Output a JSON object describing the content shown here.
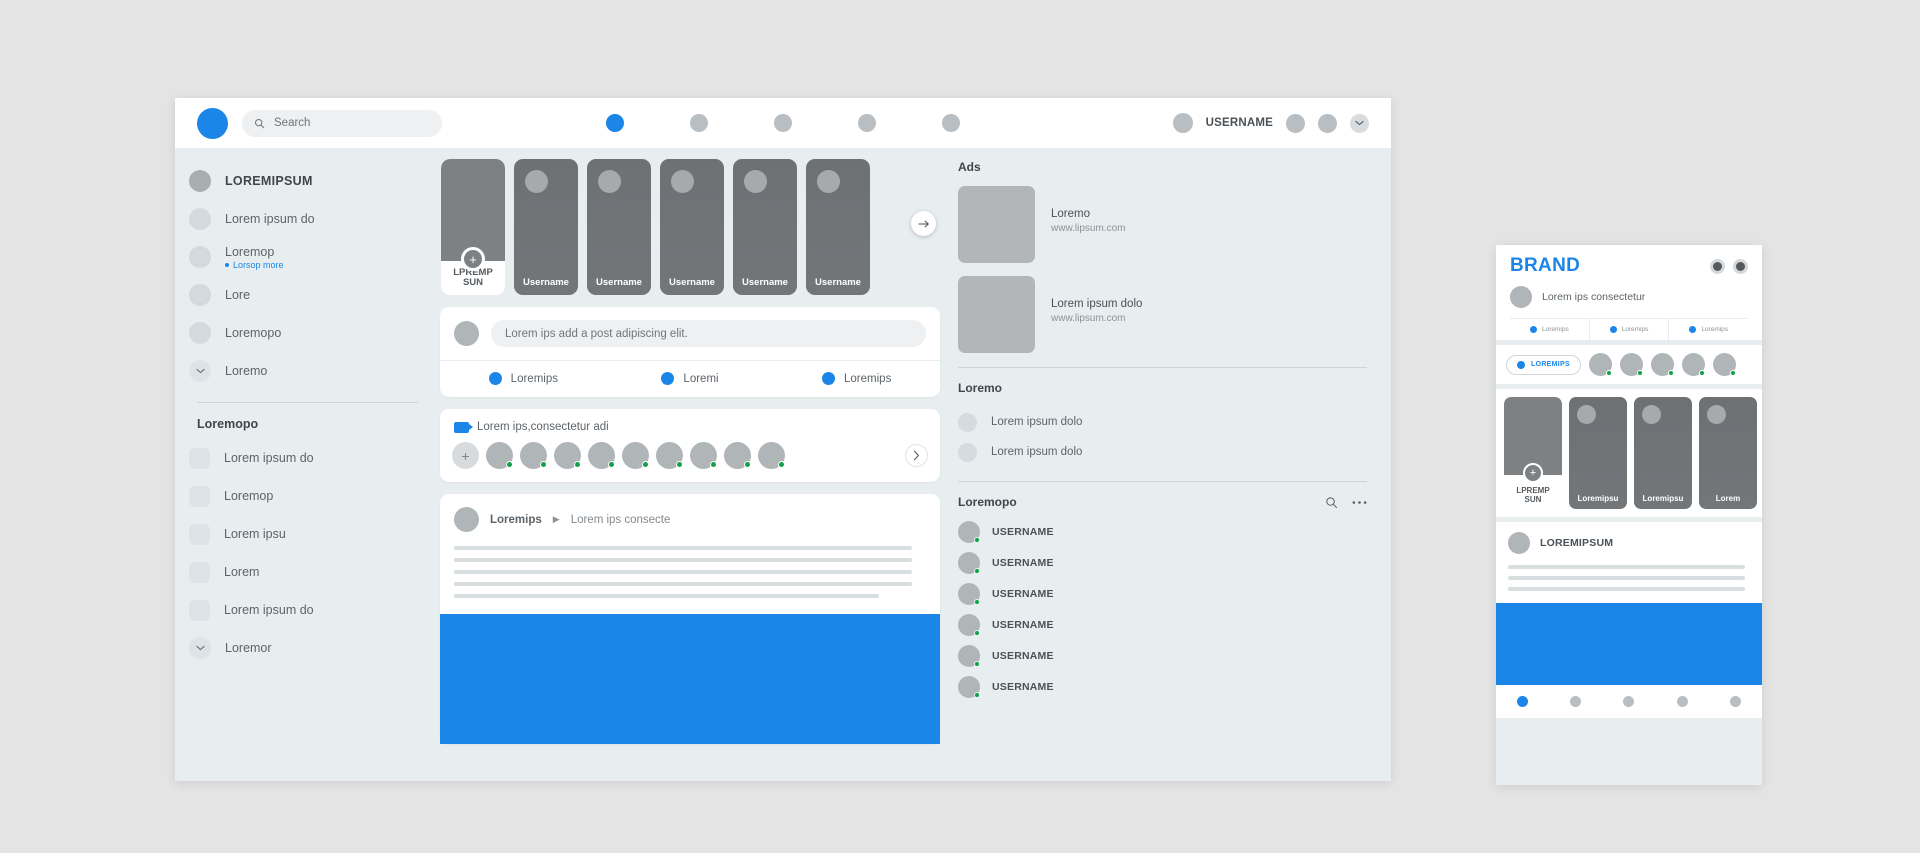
{
  "desktop": {
    "topbar": {
      "logo_icon": "brand-logo-circle",
      "search": {
        "placeholder": "Search",
        "value": "",
        "icon": "search-icon"
      },
      "nav_items": [
        {
          "name": "nav-home",
          "active": true
        },
        {
          "name": "nav-friends",
          "active": false
        },
        {
          "name": "nav-video",
          "active": false
        },
        {
          "name": "nav-marketplace",
          "active": false
        },
        {
          "name": "nav-groups",
          "active": false
        }
      ],
      "username": "USERNAME",
      "action_icons": [
        "messenger-icon",
        "notifications-icon",
        "chevron-down-icon"
      ]
    },
    "sidebar": {
      "profile": {
        "label": "LOREMIPSUM"
      },
      "items": [
        {
          "label": "Lorem ipsum do",
          "sub": ""
        },
        {
          "label": "Loremop",
          "sub": "Lorsop more"
        },
        {
          "label": "Lore",
          "sub": ""
        },
        {
          "label": "Loremopo",
          "sub": ""
        },
        {
          "label": "Loremo",
          "sub": "",
          "chevron": true
        }
      ],
      "group_title": "Loremopo",
      "group_items": [
        {
          "label": "Lorem ipsum do"
        },
        {
          "label": "Loremop"
        },
        {
          "label": "Lorem ipsu"
        },
        {
          "label": "Lorem"
        },
        {
          "label": "Lorem ipsum do"
        },
        {
          "label": "Loremor",
          "chevron": true
        }
      ]
    },
    "stories": {
      "create": {
        "line1": "LPREMP",
        "line2": "SUN",
        "plus_icon": "plus-icon"
      },
      "items": [
        {
          "name": "Username"
        },
        {
          "name": "Username"
        },
        {
          "name": "Username"
        },
        {
          "name": "Username"
        },
        {
          "name": "Username"
        }
      ],
      "next_icon": "arrow-right-icon"
    },
    "composer": {
      "placeholder": "Lorem ips add a post adipiscing elit.",
      "actions": [
        {
          "label": "Loremips"
        },
        {
          "label": "Loremi"
        },
        {
          "label": "Loremips"
        }
      ]
    },
    "live": {
      "icon": "video-camera-icon",
      "title": "Lorem ips,consectetur adi",
      "add_icon": "plus-icon",
      "avatars": 9,
      "next_icon": "chevron-right-icon"
    },
    "post": {
      "author": "Loremips",
      "separator": "▶",
      "subtitle": "Lorem ips consecte",
      "lines": 5
    },
    "right": {
      "ads_title": "Ads",
      "ads": [
        {
          "name": "Loremo",
          "url": "www.lipsum.com"
        },
        {
          "name": "Lorem ipsum dolo",
          "url": "www.lipsum.com"
        }
      ],
      "section2_title": "Loremo",
      "section2_items": [
        {
          "label": "Lorem ipsum dolo"
        },
        {
          "label": "Lorem ipsum dolo"
        }
      ],
      "contacts_title": "Loremopo",
      "contacts_actions": [
        "search-icon",
        "more-horizontal-icon"
      ],
      "contacts": [
        {
          "name": "USERNAME"
        },
        {
          "name": "USERNAME"
        },
        {
          "name": "USERNAME"
        },
        {
          "name": "USERNAME"
        },
        {
          "name": "USERNAME"
        },
        {
          "name": "USERNAME"
        }
      ]
    }
  },
  "phone": {
    "brand": "BRAND",
    "header_icons": [
      "messenger-icon",
      "notifications-icon"
    ],
    "user_label": "Lorem ips consectetur",
    "tabs": [
      {
        "label": "Loremips"
      },
      {
        "label": "Loremips"
      },
      {
        "label": "Loremips"
      }
    ],
    "story_pill": {
      "label": "LOREMIPS"
    },
    "strip_avatars": 5,
    "stories": {
      "create": {
        "line1": "LPREMP",
        "line2": "SUN",
        "plus_icon": "plus-icon"
      },
      "items": [
        {
          "name": "Loremipsu"
        },
        {
          "name": "Loremipsu"
        },
        {
          "name": "Lorem"
        }
      ]
    },
    "post": {
      "author": "LOREMIPSUM",
      "lines": 3
    },
    "nav_items": [
      {
        "name": "nav-home",
        "active": true
      },
      {
        "name": "nav-friends",
        "active": false
      },
      {
        "name": "nav-video",
        "active": false
      },
      {
        "name": "nav-notifications",
        "active": false
      },
      {
        "name": "nav-menu",
        "active": false
      }
    ]
  },
  "colors": {
    "accent": "#1b86e8",
    "online": "#13a04a",
    "surface": "#ffffff",
    "page": "#e8eef0"
  }
}
